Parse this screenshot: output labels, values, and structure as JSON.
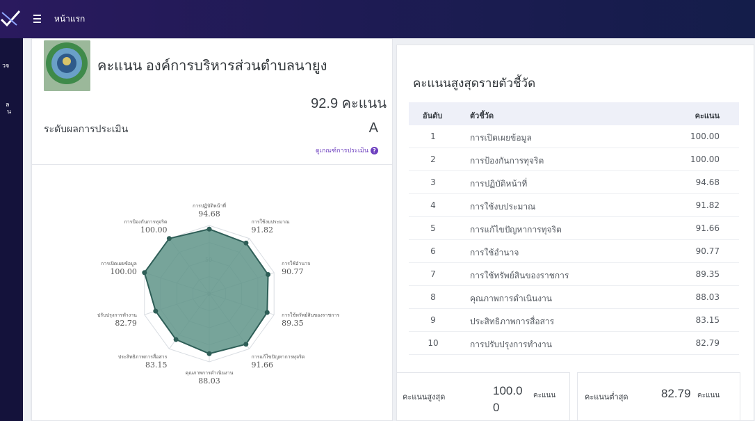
{
  "nav": {
    "home_label": "หน้าแรก"
  },
  "sidebar": {
    "items": [
      {
        "label": "วจ"
      },
      {
        "label": "ูล"
      },
      {
        "label": "น"
      }
    ]
  },
  "org": {
    "title": "คะแนน องค์การบริหารส่วนตำบลนายูง"
  },
  "summary": {
    "total_score": "92.9 คะแนน",
    "level_label": "ระดับผลการประเมิน",
    "level_value": "A",
    "criteria_link": "ดูเกณฑ์การประเมิน"
  },
  "ranking": {
    "title": "คะแนนสูงสุดรายตัวชี้วัด",
    "headers": {
      "rank": "อันดับ",
      "indicator": "ตัวชี้วัด",
      "score": "คะแนน"
    },
    "rows": [
      {
        "rank": "1",
        "name": "การเปิดเผยข้อมูล",
        "score": "100.00"
      },
      {
        "rank": "2",
        "name": "การป้องกันการทุจริต",
        "score": "100.00"
      },
      {
        "rank": "3",
        "name": "การปฏิบัติหน้าที่",
        "score": "94.68"
      },
      {
        "rank": "4",
        "name": "การใช้งบประมาณ",
        "score": "91.82"
      },
      {
        "rank": "5",
        "name": "การแก้ไขปัญหาการทุจริต",
        "score": "91.66"
      },
      {
        "rank": "6",
        "name": "การใช้อำนาจ",
        "score": "90.77"
      },
      {
        "rank": "7",
        "name": "การใช้ทรัพย์สินของราชการ",
        "score": "89.35"
      },
      {
        "rank": "8",
        "name": "คุณภาพการดำเนินงาน",
        "score": "88.03"
      },
      {
        "rank": "9",
        "name": "ประสิทธิภาพการสื่อสาร",
        "score": "83.15"
      },
      {
        "rank": "10",
        "name": "การปรับปรุงการทำงาน",
        "score": "82.79"
      }
    ]
  },
  "stats": {
    "max_label": "คะแนนสูงสุด",
    "max_value_line1": "100.0",
    "max_value_line2": "0",
    "max_unit": "คะแนน",
    "min_label": "คะแนนต่ำสุด",
    "min_value": "82.79",
    "min_unit": "คะแนน"
  },
  "chart_data": {
    "type": "radar",
    "max": 100,
    "ring_labels": [
      "0",
      "50"
    ],
    "categories": [
      "การปฏิบัติหน้าที่",
      "การใช้งบประมาณ",
      "การใช้อำนาจ",
      "การใช้ทรัพย์สินของราชการ",
      "การแก้ไขปัญหาการทุจริต",
      "คุณภาพการดำเนินงาน",
      "ประสิทธิภาพการสื่อสาร",
      "การปรับปรุงการทำงาน",
      "การเปิดเผยข้อมูล",
      "การป้องกันการทุจริต"
    ],
    "value_labels": [
      "94.68",
      "91.82",
      "90.77",
      "89.35",
      "91.66",
      "88.03",
      "83.15",
      "82.79",
      "100.00",
      "100.00"
    ],
    "values": [
      94.68,
      91.82,
      90.77,
      89.35,
      91.66,
      88.03,
      83.15,
      82.79,
      100.0,
      100.0
    ],
    "fill_color": "#5f9488",
    "stroke_color": "#2e5e57"
  }
}
